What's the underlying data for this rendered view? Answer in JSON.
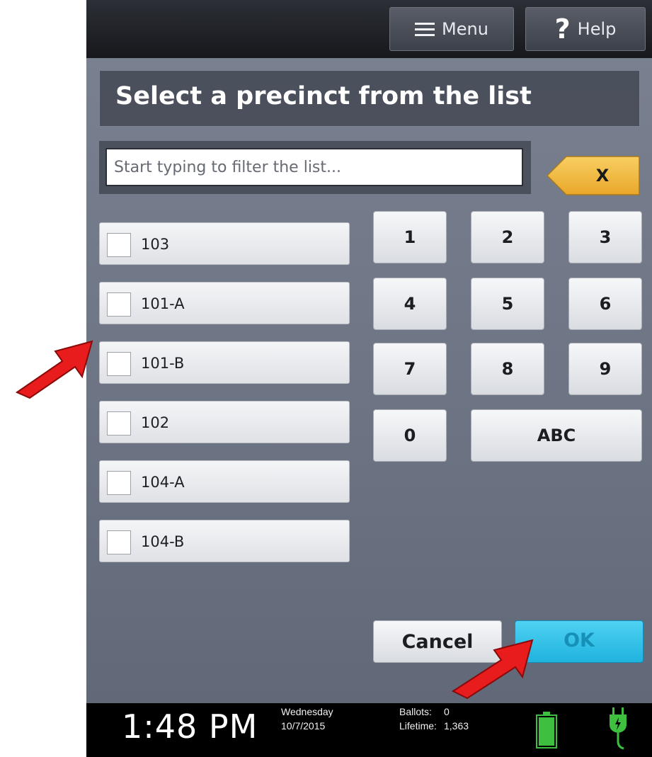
{
  "header": {
    "menu_label": "Menu",
    "help_label": "Help",
    "menu_icon": "hamburger-icon",
    "help_icon": "question-mark-icon"
  },
  "title": "Select a precinct from the list",
  "filter": {
    "placeholder": "Start typing to filter the list...",
    "value": "",
    "clear_label": "X",
    "clear_color": "#f2b93b"
  },
  "precincts": [
    "103",
    "101-A",
    "101-B",
    "102",
    "104-A",
    "104-B"
  ],
  "keypad": {
    "keys": [
      "1",
      "2",
      "3",
      "4",
      "5",
      "6",
      "7",
      "8",
      "9",
      "0",
      "ABC"
    ]
  },
  "actions": {
    "cancel_label": "Cancel",
    "ok_label": "OK",
    "ok_color": "#2ec3ea"
  },
  "status": {
    "time": "1:48 PM",
    "day": "Wednesday",
    "date": "10/7/2015",
    "ballots_label": "Ballots:",
    "ballots_value": "0",
    "lifetime_label": "Lifetime:",
    "lifetime_value": "1,363",
    "battery_icon": "battery-icon",
    "power_icon": "power-plug-icon",
    "status_color": "#3fbf3f"
  },
  "annotations": {
    "arrow_color": "#e81c1c"
  }
}
